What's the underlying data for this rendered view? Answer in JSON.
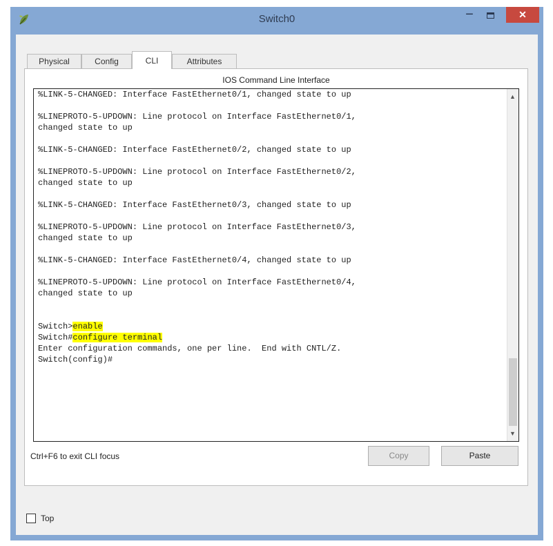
{
  "window": {
    "title": "Switch0",
    "minimize_glyph": "−",
    "close_glyph": "✕",
    "app_icon": "leaf-icon",
    "colors": {
      "frame": "#85a8d4",
      "close": "#c7493f",
      "highlight": "#ffff00"
    }
  },
  "tabs": [
    {
      "label": "Physical",
      "active": false
    },
    {
      "label": "Config",
      "active": false
    },
    {
      "label": "CLI",
      "active": true
    },
    {
      "label": "Attributes",
      "active": false
    }
  ],
  "cli": {
    "heading": "IOS Command Line Interface",
    "lines": [
      "%LINK-5-CHANGED: Interface FastEthernet0/1, changed state to up",
      "",
      "%LINEPROTO-5-UPDOWN: Line protocol on Interface FastEthernet0/1,",
      "changed state to up",
      "",
      "%LINK-5-CHANGED: Interface FastEthernet0/2, changed state to up",
      "",
      "%LINEPROTO-5-UPDOWN: Line protocol on Interface FastEthernet0/2,",
      "changed state to up",
      "",
      "%LINK-5-CHANGED: Interface FastEthernet0/3, changed state to up",
      "",
      "%LINEPROTO-5-UPDOWN: Line protocol on Interface FastEthernet0/3,",
      "changed state to up",
      "",
      "%LINK-5-CHANGED: Interface FastEthernet0/4, changed state to up",
      "",
      "%LINEPROTO-5-UPDOWN: Line protocol on Interface FastEthernet0/4,",
      "changed state to up",
      "",
      ""
    ],
    "prompt_lines": [
      {
        "prompt": "Switch>",
        "command": "enable"
      },
      {
        "prompt": "Switch#",
        "command": "configure terminal"
      }
    ],
    "tail_lines": [
      "Enter configuration commands, one per line.  End with CNTL/Z.",
      "Switch(config)#"
    ],
    "footer_hint": "Ctrl+F6 to exit CLI focus",
    "copy_label": "Copy",
    "paste_label": "Paste"
  },
  "top_checkbox": {
    "label": "Top",
    "checked": false
  }
}
